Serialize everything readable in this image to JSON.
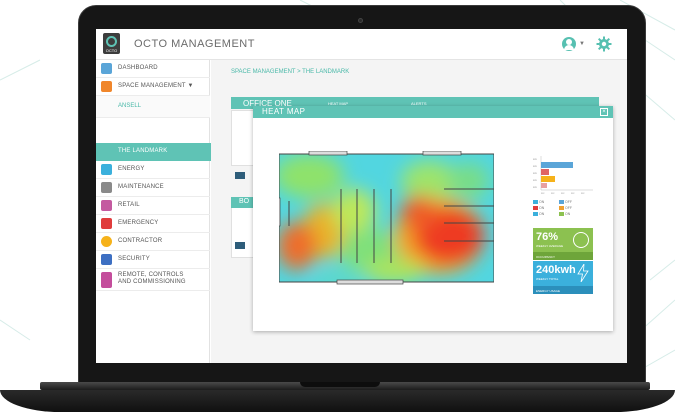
{
  "app": {
    "title": "OCTO MANAGEMENT",
    "logo_text": "OCTO"
  },
  "sidebar": {
    "items": [
      {
        "label": "DASHBOARD",
        "icon": "dashboard-icon",
        "color": "#5aa5d8"
      },
      {
        "label": "SPACE MANAGEMENT ▼",
        "icon": "space-icon",
        "color": "#f0862b"
      },
      {
        "label": "ANSELL",
        "sub": true
      },
      {
        "label": "THE LANDMARK",
        "sub": true,
        "active": true
      },
      {
        "label": "ENERGY",
        "icon": "energy-icon",
        "color": "#3bb0dc"
      },
      {
        "label": "MAINTENANCE",
        "icon": "wrench-icon",
        "color": "#8a8a8a"
      },
      {
        "label": "RETAIL",
        "icon": "cart-icon",
        "color": "#c45aa0"
      },
      {
        "label": "EMERGENCY",
        "icon": "emergency-icon",
        "color": "#e03c3c"
      },
      {
        "label": "CONTRACTOR",
        "icon": "contractor-icon",
        "color": "#f6b21a"
      },
      {
        "label": "SECURITY",
        "icon": "shield-icon",
        "color": "#3d6fc2"
      },
      {
        "label": "REMOTE, CONTROLS",
        "label2": "AND COMMISSIONING",
        "icon": "remote-icon",
        "color": "#c44d9c"
      }
    ]
  },
  "main": {
    "breadcrumb": "SPACE MANAGEMENT > THE LANDMARK",
    "office_title": "OFFICE ONE",
    "tabs": [
      "HEAT MAP",
      "ALERTS"
    ],
    "second_title": "BO"
  },
  "modal": {
    "title": "HEAT MAP",
    "close": "×"
  },
  "kpis": {
    "occupancy_value": "76%",
    "occupancy_sub": "WEEKLY AVERAGE",
    "occupancy_foot": "OCCUPANCY",
    "energy_value": "240kwh",
    "energy_sub": "WEEKLY TOTAL",
    "energy_foot": "ENERGY USAGE"
  },
  "legend": [
    {
      "label": "ON",
      "color": "#3bb0dc"
    },
    {
      "label": "ON",
      "color": "#3bb0dc"
    },
    {
      "label": "ON",
      "color": "#e03c3c"
    },
    {
      "label": "OFF",
      "color": "#5aa5d8"
    },
    {
      "label": "OFF",
      "color": "#f0a030"
    },
    {
      "label": "ON",
      "color": "#8cc150"
    }
  ],
  "colors": {
    "accent": "#5fc3b5",
    "green_tile": "#8cc150",
    "blue_tile": "#3bb0dc"
  }
}
